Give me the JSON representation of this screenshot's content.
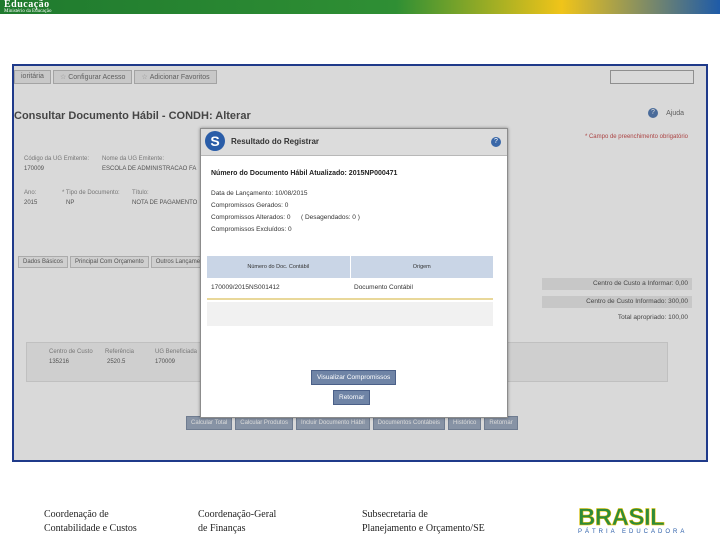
{
  "header": {
    "logo_line1": "Educação",
    "logo_line2": "Ministério da Educação"
  },
  "app": {
    "nav_tabs": [
      {
        "label": "ioritária"
      },
      {
        "label": "Configurar Acesso"
      },
      {
        "label": "Adicionar Favoritos"
      }
    ],
    "page_title": "Consultar Documento Hábil - CONDH: Alterar",
    "help_label": "Ajuda",
    "required_note": "* Campo de preenchimento obrigatório",
    "fields": {
      "codigo_ug_label": "Código da UG Emitente:",
      "codigo_ug_value": "170009",
      "nome_ug_label": "Nome da UG Emitente:",
      "nome_ug_value": "ESCOLA DE ADMINISTRACAO FA",
      "ano_label": "Ano:",
      "ano_value": "2015",
      "tipo_label": "* Tipo de Documento:",
      "tipo_value": "NP",
      "titulo_label": "Título:",
      "titulo_value": "NOTA DE PAGAMENTO"
    },
    "sub_tabs": [
      "Dados Básicos",
      "Principal Com Orçamento",
      "Outros Lançamentos"
    ],
    "cost_center": {
      "informar": "Centro de Custo a Informar: 0,00",
      "informado": "Centro de Custo Informado: 300,00",
      "total": "Total apropriado: 100,00",
      "cols": [
        "Centro de Custo",
        "Referência",
        "UG Beneficiada"
      ],
      "row": [
        "135216",
        "2520.5",
        "170009"
      ]
    },
    "bottom_buttons": [
      "Calcular Total",
      "Calcular Produtos",
      "Incluir Documento Hábil",
      "Documentos Contábeis",
      "Histórico",
      "Retornar"
    ]
  },
  "modal": {
    "title": "Resultado do Registrar",
    "numero_label": "Número do Documento Hábil Atualizado: 2015NP000471",
    "data_lancamento": "Data de Lançamento: 10/08/2015",
    "compromissos_gerados": "Compromissos Gerados: 0",
    "compromissos_alterados": "Compromissos Alterados: 0",
    "desagendados": "( Desagendados: 0 )",
    "compromissos_excluidos": "Compromissos Excluídos: 0",
    "table_headers": [
      "Número do Doc. Contábil",
      "Origem"
    ],
    "table_row": [
      "170009/2015NS001412",
      "Documento Contábil"
    ],
    "btn_visualizar": "Visualizar Compromissos",
    "btn_retornar": "Retornar"
  },
  "footer": {
    "col1_line1": "Coordenação de",
    "col1_line2": "Contabilidade e Custos",
    "col2_line1": "Coordenação-Geral",
    "col2_line2": "de Finanças",
    "col3_line1": "Subsecretaria de",
    "col3_line2": "Planejamento e Orçamento/SE",
    "brand_word": "BRASIL",
    "brand_sub": "PÁTRIA EDUCADORA"
  }
}
